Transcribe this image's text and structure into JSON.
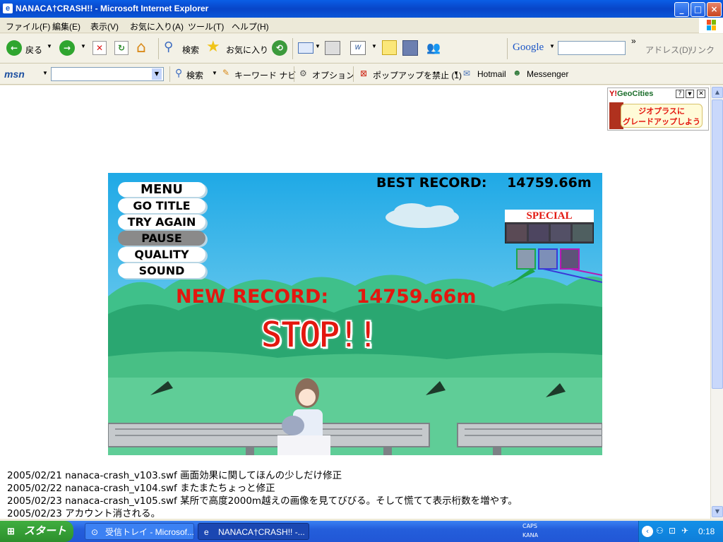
{
  "window": {
    "title": "NANACA†CRASH!! - Microsoft Internet Explorer",
    "controls": [
      "_",
      "□",
      "×"
    ]
  },
  "menubar": [
    "ファイル(F)",
    "編集(E)",
    "表示(V)",
    "お気に入り(A)",
    "ツール(T)",
    "ヘルプ(H)"
  ],
  "toolbar": {
    "back": "戻る",
    "search": "検索",
    "favorites": "お気に入り",
    "google": "Google",
    "address": "アドレス(D)",
    "links": "リンク",
    "more": "»"
  },
  "msnbar": {
    "brand": "msn",
    "search": "検索",
    "keyword": "キーワード ナビ",
    "options": "オプション",
    "popup": "ポップアップを禁止 (1)",
    "hotmail": "Hotmail",
    "messenger": "Messenger"
  },
  "geocities": {
    "brand": "GeoCities",
    "ad_line1": "ジオプラスに",
    "ad_line2": "グレードアップしよう"
  },
  "game": {
    "best_label": "BEST RECORD:",
    "best_value": "14759.66m",
    "menu": [
      "MENU",
      "GO TITLE",
      "TRY AGAIN",
      "PAUSE",
      "QUALITY",
      "SOUND"
    ],
    "new_record_label": "NEW RECORD:",
    "new_record_value": "14759.66m",
    "stop": "STOP!!",
    "special": "SPECIAL",
    "colors": {
      "sky": "#1fa9e6",
      "red": "#e3170f",
      "grass": "#3fc08a"
    }
  },
  "log": [
    "2005/02/21 nanaca-crash_v103.swf 画面効果に関してほんの少しだけ修正",
    "2005/02/22 nanaca-crash_v104.swf またまたちょっと修正",
    "2005/02/23 nanaca-crash_v105.swf 某所で高度2000m越えの画像を見てびびる。そして慌てて表示桁数を増やす。",
    "2005/02/23 アカウント消される。"
  ],
  "taskbar": {
    "start": "スタート",
    "tasks": [
      "受信トレイ - Microsof...",
      "NANACA†CRASH!! -..."
    ],
    "caps": "CAPS",
    "kana": "KANA",
    "clock": "0:18"
  }
}
